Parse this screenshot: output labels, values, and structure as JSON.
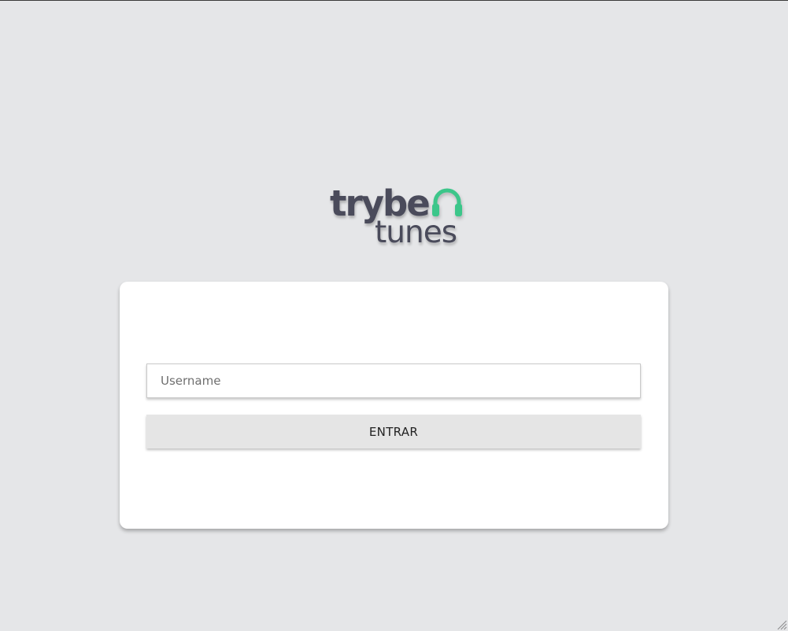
{
  "logo": {
    "word_top": "trybe",
    "word_bottom": "tunes",
    "icon": "headphones-icon",
    "icon_color": "#3cc68a",
    "text_color": "#4a4b5b"
  },
  "login": {
    "username_placeholder": "Username",
    "username_value": "",
    "submit_label": "ENTRAR"
  },
  "colors": {
    "background": "#e5e6e8",
    "card": "#ffffff",
    "button": "#e5e5e5"
  }
}
